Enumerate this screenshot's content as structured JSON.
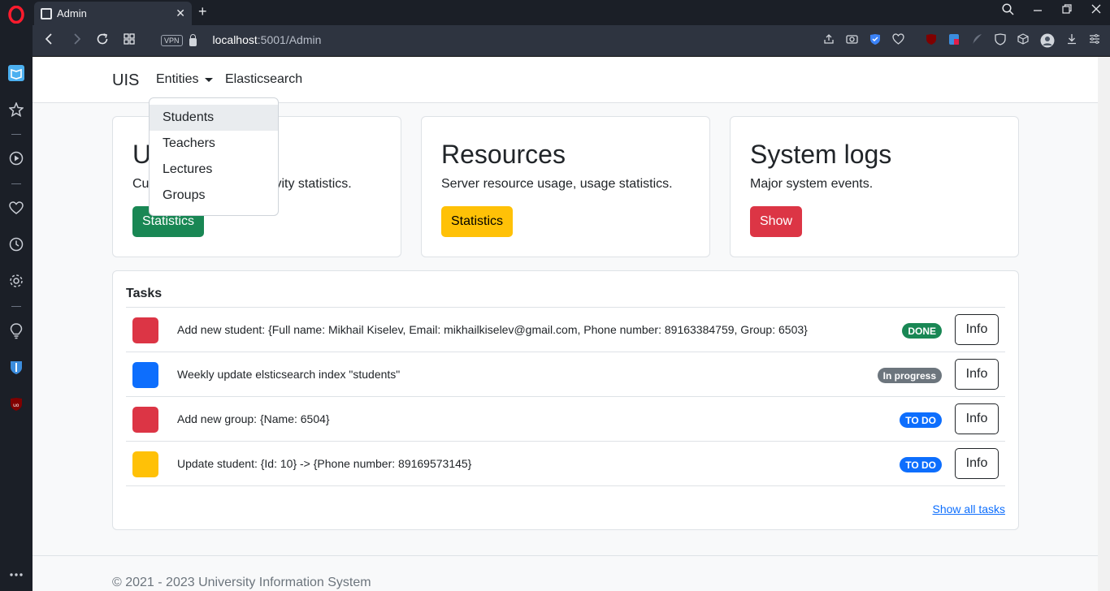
{
  "browser": {
    "tab_title": "Admin",
    "url_host": "localhost",
    "url_path": ":5001/Admin",
    "vpn_label": "VPN"
  },
  "nav": {
    "brand": "UIS",
    "entities": "Entities",
    "elasticsearch": "Elasticsearch",
    "dropdown": [
      {
        "label": "Students",
        "active": true
      },
      {
        "label": "Teachers",
        "active": false
      },
      {
        "label": "Lectures",
        "active": false
      },
      {
        "label": "Groups",
        "active": false
      }
    ]
  },
  "cards": {
    "users": {
      "title_visible": "U",
      "desc_start": "Cu",
      "desc_end": "vity statistics.",
      "button": "Statistics"
    },
    "resources": {
      "title": "Resources",
      "desc": "Server resource usage, usage statistics.",
      "button": "Statistics"
    },
    "logs": {
      "title": "System logs",
      "desc": "Major system events.",
      "button": "Show"
    }
  },
  "tasks": {
    "title": "Tasks",
    "items": [
      {
        "color": "#dc3545",
        "text": "Add new student: {Full name: Mikhail Kiselev, Email: mikhailkiselev@gmail.com, Phone number: 89163384759, Group: 6503}",
        "badge": "DONE",
        "badge_color": "#198754",
        "info": "Info"
      },
      {
        "color": "#0d6efd",
        "text": "Weekly update elsticsearch index \"students\"",
        "badge": "In progress",
        "badge_color": "#6c757d",
        "info": "Info"
      },
      {
        "color": "#dc3545",
        "text": "Add new group: {Name: 6504}",
        "badge": "TO DO",
        "badge_color": "#0d6efd",
        "info": "Info"
      },
      {
        "color": "#ffc107",
        "text": "Update student: {Id: 10} -> {Phone number: 89169573145}",
        "badge": "TO DO",
        "badge_color": "#0d6efd",
        "info": "Info"
      }
    ],
    "show_all": "Show all tasks"
  },
  "footer": {
    "text": "© 2021 - 2023 University Information System"
  },
  "colors": {
    "accent": "#0d6efd",
    "success": "#198754",
    "warning": "#ffc107",
    "danger": "#dc3545",
    "secondary": "#6c757d"
  }
}
